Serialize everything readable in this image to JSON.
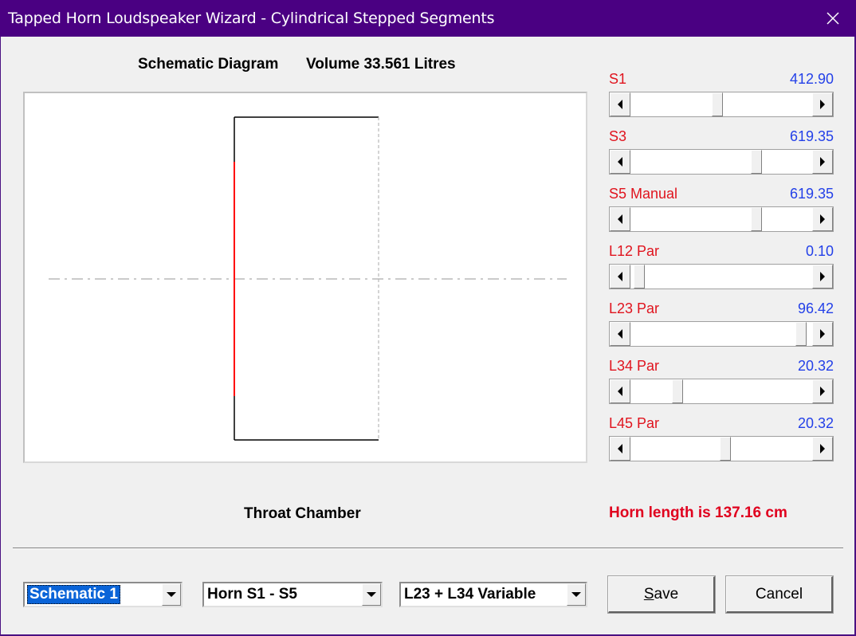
{
  "window": {
    "title": "Tapped Horn Loudspeaker Wizard - Cylindrical Stepped Segments",
    "close_icon": "close-icon"
  },
  "diagram": {
    "heading": "Schematic Diagram",
    "volume_text": "Volume 33.561 Litres",
    "caption": "Throat Chamber"
  },
  "sliders": [
    {
      "label": "S1",
      "value": "412.90",
      "position": 0.47
    },
    {
      "label": "S3",
      "value": "619.35",
      "position": 0.7
    },
    {
      "label": "S5  Manual",
      "value": "619.35",
      "position": 0.7
    },
    {
      "label": "L12  Par",
      "value": "0.10",
      "position": 0.02
    },
    {
      "label": "L23  Par",
      "value": "96.42",
      "position": 0.96
    },
    {
      "label": "L34  Par",
      "value": "20.32",
      "position": 0.24
    },
    {
      "label": "L45  Par",
      "value": "20.32",
      "position": 0.52
    }
  ],
  "horn_length": "Horn length is 137.16 cm",
  "combos": {
    "schematic": "Schematic 1",
    "horn": "Horn S1 - S5",
    "variable": "L23 + L34 Variable"
  },
  "buttons": {
    "save_label_prefix": "",
    "save_underline": "S",
    "save_label_rest": "ave",
    "cancel_label": "Cancel"
  },
  "colors": {
    "titlebar": "#4a0082",
    "label_red": "#e0141e",
    "value_blue": "#2340e8",
    "schematic_red": "#ff0000"
  }
}
